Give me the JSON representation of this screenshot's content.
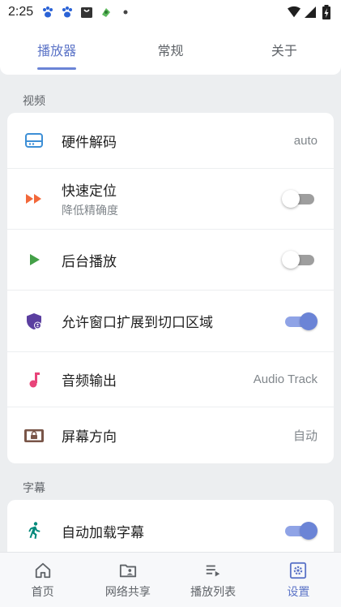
{
  "status_bar": {
    "time": "2:25"
  },
  "top_tabs": [
    {
      "label": "播放器",
      "active": true
    },
    {
      "label": "常规",
      "active": false
    },
    {
      "label": "关于",
      "active": false
    }
  ],
  "sections": {
    "video": {
      "header": "视频",
      "items": [
        {
          "title": "硬件解码",
          "value": "auto",
          "icon": "hard-drive-icon",
          "icon_color": "#3d8fd6"
        },
        {
          "title": "快速定位",
          "subtitle": "降低精确度",
          "icon": "fast-forward-icon",
          "icon_color": "#f2683a",
          "switch_on": false
        },
        {
          "title": "后台播放",
          "icon": "play-icon",
          "icon_color": "#43a047",
          "switch_on": false
        },
        {
          "title": "允许窗口扩展到切口区域",
          "icon": "shield-user-icon",
          "icon_color": "#5b3fa0",
          "switch_on": true
        },
        {
          "title": "音频输出",
          "value": "Audio Track",
          "icon": "music-note-icon",
          "icon_color": "#e84479"
        },
        {
          "title": "屏幕方向",
          "value": "自动",
          "icon": "screen-lock-icon",
          "icon_color": "#795548"
        }
      ]
    },
    "subtitles": {
      "header": "字幕",
      "items": [
        {
          "title": "自动加载字幕",
          "icon": "running-person-icon",
          "icon_color": "#00897b",
          "switch_on": true
        }
      ]
    }
  },
  "bottom_nav": [
    {
      "label": "首页",
      "icon": "home-icon",
      "active": false
    },
    {
      "label": "网络共享",
      "icon": "folder-share-icon",
      "active": false
    },
    {
      "label": "播放列表",
      "icon": "playlist-icon",
      "active": false
    },
    {
      "label": "设置",
      "icon": "settings-icon",
      "active": true
    }
  ],
  "colors": {
    "accent": "#5c74c7",
    "switch_on_track": "#8fa3e6",
    "switch_off_track": "#9e9e9e",
    "background": "#eceef0"
  }
}
